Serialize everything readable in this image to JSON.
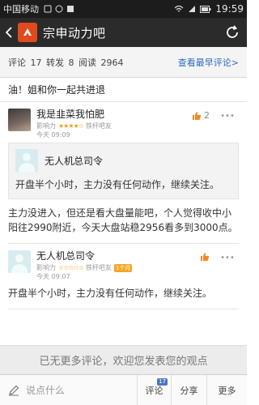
{
  "status_bar": {
    "carrier": "中国移动",
    "time": "19:59"
  },
  "nav": {
    "title": "宗申动力吧"
  },
  "stats": {
    "comments_label": "评论",
    "comments_count": "17",
    "reposts_label": "转发",
    "reposts_count": "8",
    "reads_label": "阅读",
    "reads_count": "2964",
    "early_link": "查看最早评论>"
  },
  "post": {
    "title_line": "油！姐和你一起共进退"
  },
  "comments": [
    {
      "user": "我是韭菜我怕肥",
      "influence_label": "影响力",
      "stars": "★★★★☆",
      "fan_label": "铁杆吧友",
      "time": "今天 09:09",
      "like_count": "2",
      "quote": {
        "user": "无人机总司令",
        "text": "开盘半个小时，主力没有任何动作，继续关注。"
      },
      "body": "主力没进入，但还是看大盘量能吧，个人觉得收中小阳往2990附近，今天大盘站稳2956看多到3000点。"
    },
    {
      "user": "无人机总司令",
      "influence_label": "影响力",
      "stars": "☆☆☆☆☆",
      "fan_label": "铁杆吧友",
      "badge": "1个月",
      "time": "今天 09:07",
      "body": "开盘半个小时，主力没有任何动作，继续关注。"
    }
  ],
  "end_message": "已无更多评论，欢迎您发表您的观点",
  "bottom_bar": {
    "input_placeholder": "说点什么",
    "comment_label": "评论",
    "comment_count": "17",
    "share_label": "分享",
    "more_label": "更多"
  },
  "colors": {
    "nav_bg": "#2b2b2b",
    "accent_orange": "#e04a1c",
    "link_blue": "#2a6cbf"
  },
  "icons": [
    "back-icon",
    "app-logo-icon",
    "refresh-icon",
    "like-icon",
    "more-icon",
    "edit-icon",
    "wifi-icon",
    "battery-icon",
    "signal-icon"
  ]
}
